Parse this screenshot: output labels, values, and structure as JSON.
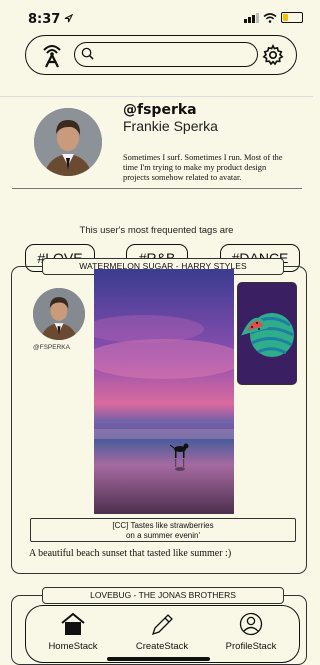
{
  "status_bar": {
    "time": "8:37"
  },
  "profile": {
    "username": "@fsperka",
    "full_name": "Frankie Sperka",
    "bio_line1": "Sometimes I surf. Sometimes I run. Most of the",
    "bio_line2": "time I'm trying to make my product design",
    "bio_line3": "projects somehow related to avatar."
  },
  "tags": {
    "title": "This user's most frequented tags are",
    "items": [
      "#LOVE",
      "#R&B",
      "#DANCE"
    ]
  },
  "posts": [
    {
      "song_title": "WATERMELON SUGAR - HARRY STYLES",
      "poster_handle": "@FSPERKA",
      "caption_line1": "[CC] Tastes like strawberries",
      "caption_line2": "on a summer evenin'",
      "description": "A beautiful beach sunset that tasted like summer :)"
    },
    {
      "song_title": "LOVEBUG - THE JONAS BROTHERS"
    }
  ],
  "bottom_nav": {
    "home": "HomeStack",
    "create": "CreateStack",
    "profile": "ProfileStack"
  },
  "colors": {
    "background": "#f9f8e6",
    "sticker_background": "#3a1f63",
    "watermelon_green": "#2fae8c",
    "watermelon_red": "#e54b4b"
  }
}
